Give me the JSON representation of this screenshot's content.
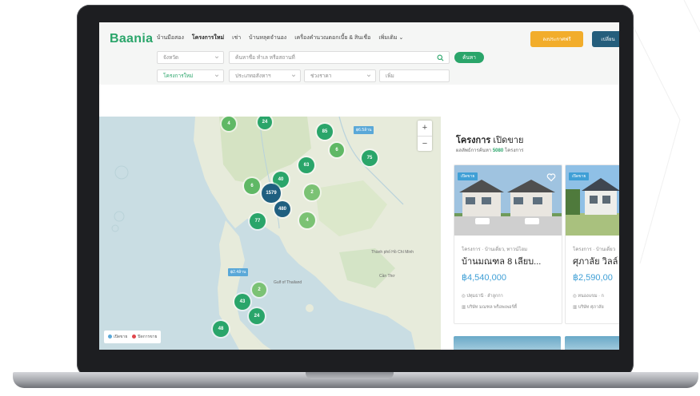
{
  "header": {
    "logo": "Baania",
    "nav": [
      "บ้านมือสอง",
      "โครงการใหม่",
      "เช่า",
      "บ้านหลุดจำนอง",
      "เครื่องคำนวณดอกเบี้ย & สินเชื่อ",
      "เพิ่มเติม"
    ],
    "active_nav": "โครงการใหม่",
    "post_button": "ลงประกาศฟรี",
    "dark_button": "เปลี่ยน"
  },
  "search": {
    "province_placeholder": "จังหวัด",
    "keyword_placeholder": "ค้นหาชื่อ ทำเล หรือสถานที่",
    "type_value": "โครงการใหม่",
    "property_type_placeholder": "ประเภทอสังหาฯ",
    "price_placeholder": "ช่วงราคา",
    "more_placeholder": "เพิ่ม",
    "search_button": "ค้นหา"
  },
  "map": {
    "clusters": [
      {
        "label": "4",
        "color": "#5fb865"
      },
      {
        "label": "24",
        "color": "#2aa56a"
      },
      {
        "label": "85",
        "color": "#2aa56a"
      },
      {
        "label": "6",
        "color": "#5fb865"
      },
      {
        "label": "75",
        "color": "#2aa56a"
      },
      {
        "label": "63",
        "color": "#2aa56a"
      },
      {
        "label": "40",
        "color": "#2aa56a"
      },
      {
        "label": "6",
        "color": "#5fb865"
      },
      {
        "label": "1579",
        "color": "#1f5f80"
      },
      {
        "label": "2",
        "color": "#7bc274"
      },
      {
        "label": "480",
        "color": "#1f5f80"
      },
      {
        "label": "77",
        "color": "#2aa56a"
      },
      {
        "label": "4",
        "color": "#7bc274"
      },
      {
        "label": "2",
        "color": "#7bc274"
      },
      {
        "label": "43",
        "color": "#2aa56a"
      },
      {
        "label": "24",
        "color": "#2aa56a"
      },
      {
        "label": "48",
        "color": "#2aa56a"
      }
    ],
    "price_tags": [
      "฿6.5ล้าน",
      "฿2.4ล้าน"
    ],
    "place_labels": [
      "Thành phố Hồ Chí Minh",
      "Cần Thơ",
      "Gulf of Thailand"
    ],
    "zoom_in": "+",
    "zoom_out": "−",
    "legend": [
      {
        "label": "เปิดขาย",
        "color": "#5aa8d8"
      },
      {
        "label": "ปิดการขาย",
        "color": "#e0474c"
      }
    ]
  },
  "panel": {
    "title_bold": "โครงการ",
    "title_rest": "เปิดขาย",
    "subtitle_prefix": "ผลลัพธ์การค้นหา",
    "count": "5080",
    "subtitle_suffix": "โครงการ",
    "cards": [
      {
        "badge": "เปิดขาย",
        "type": "โครงการ · บ้านเดี่ยว, ทาวน์โฮม",
        "name": "บ้านมณฑล 8 เลียบ...",
        "price": "฿4,540,000",
        "location": "ปทุมธานี · ลำลูกกา",
        "developer": "บริษัท มณฑล พร็อพเพอร์ตี้"
      },
      {
        "badge": "เปิดขาย",
        "type": "โครงการ · บ้านเดี่ยว",
        "name": "ศุภาลัย วิลล์",
        "price": "฿2,590,00",
        "location": "หนองแขม · ก",
        "developer": "บริษัท ศุภาลัย"
      }
    ]
  }
}
